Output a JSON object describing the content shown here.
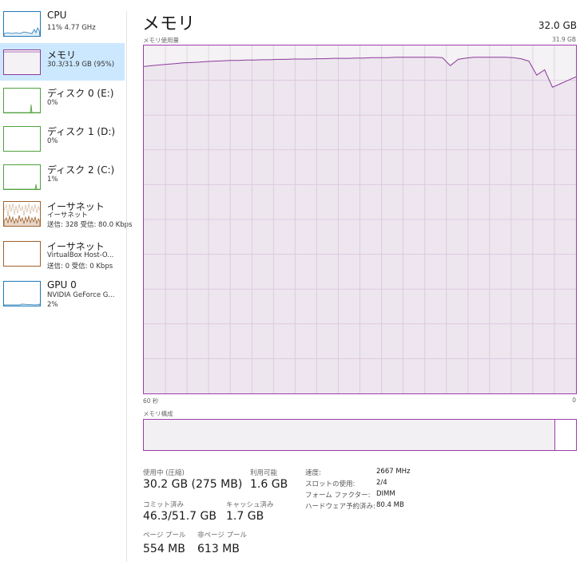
{
  "sidebar": {
    "items": [
      {
        "title": "CPU",
        "subtitle": "11% 4.77 GHz",
        "color": "#1f79b8"
      },
      {
        "title": "メモリ",
        "subtitle": "30.3/31.9 GB (95%)",
        "color": "#8c3b9c"
      },
      {
        "title": "ディスク 0 (E:)",
        "subtitle": "0%",
        "color": "#4da33d"
      },
      {
        "title": "ディスク 1 (D:)",
        "subtitle": "0%",
        "color": "#4da33d"
      },
      {
        "title": "ディスク 2 (C:)",
        "subtitle": "1%",
        "color": "#4da33d"
      },
      {
        "title": "イーサネット",
        "subtitle": "イーサネット",
        "subtitle2": "送信: 328 受信: 80.0 Kbps",
        "color": "#a0602a"
      },
      {
        "title": "イーサネット",
        "subtitle": "VirtualBox Host-O...",
        "subtitle2": "送信: 0 受信: 0 Kbps",
        "color": "#a0602a"
      },
      {
        "title": "GPU 0",
        "subtitle": "NVIDIA GeForce G...",
        "subtitle2": "2%",
        "color": "#1f79b8"
      }
    ]
  },
  "main": {
    "title": "メモリ",
    "total": "32.0 GB",
    "usage_label": "メモリ使用量",
    "usage_max": "31.9 GB",
    "time_left": "60 秒",
    "time_right": "0",
    "composition_label": "メモリ構成",
    "composition_used_fraction": 0.95,
    "accent_color": "#8c3b9c"
  },
  "stats": {
    "in_use_label": "使用中 (圧縮)",
    "in_use_value": "30.2 GB (275 MB)",
    "available_label": "利用可能",
    "available_value": "1.6 GB",
    "committed_label": "コミット済み",
    "committed_value": "46.3/51.7 GB",
    "cached_label": "キャッシュ済み",
    "cached_value": "1.7 GB",
    "paged_label": "ページ プール",
    "paged_value": "554 MB",
    "nonpaged_label": "非ページ プール",
    "nonpaged_value": "613 MB"
  },
  "details": [
    {
      "label": "速度:",
      "value": "2667 MHz"
    },
    {
      "label": "スロットの使用:",
      "value": "2/4"
    },
    {
      "label": "フォーム ファクター:",
      "value": "DIMM"
    },
    {
      "label": "ハードウェア予約済み:",
      "value": "80.4 MB"
    }
  ],
  "usage_series": [
    94.0,
    94.2,
    94.4,
    94.6,
    94.8,
    95.0,
    95.1,
    95.2,
    95.4,
    95.5,
    95.6,
    95.7,
    95.7,
    95.8,
    95.8,
    95.9,
    95.9,
    96.0,
    96.0,
    96.1,
    96.1,
    96.1,
    96.2,
    96.2,
    96.3,
    96.3,
    96.3,
    96.4,
    96.4,
    96.5,
    96.5,
    96.5,
    96.6,
    96.6,
    96.6,
    96.6,
    96.6,
    96.6,
    96.5,
    94.2,
    96.0,
    96.4,
    96.6,
    96.6,
    96.6,
    96.6,
    96.6,
    96.5,
    96.2,
    95.5,
    91.5,
    93.0,
    88.0,
    89.0,
    90.0,
    91.0
  ]
}
